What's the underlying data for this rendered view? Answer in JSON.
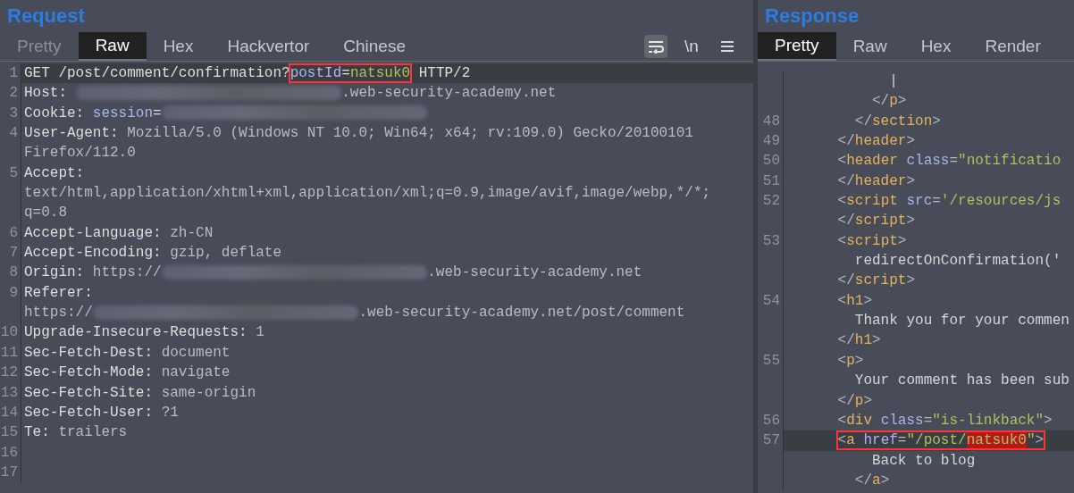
{
  "request": {
    "title": "Request",
    "tabs": [
      {
        "label": "Pretty",
        "selected": false,
        "disabled": true
      },
      {
        "label": "Raw",
        "selected": true,
        "disabled": false
      },
      {
        "label": "Hex",
        "selected": false,
        "disabled": false
      },
      {
        "label": "Hackvertor",
        "selected": false,
        "disabled": false
      },
      {
        "label": "Chinese",
        "selected": false,
        "disabled": false
      }
    ],
    "toolbar": [
      {
        "kind": "wrap",
        "selected": true
      },
      {
        "kind": "newline",
        "label": "\\n",
        "selected": false
      },
      {
        "kind": "menu",
        "selected": false
      }
    ],
    "lines": [
      {
        "number": "1",
        "current": true,
        "segments": [
          {
            "kind": "plain",
            "text": "GET /post/comment/confirmation?"
          },
          {
            "kind": "outlined",
            "segments": [
              {
                "kind": "param",
                "text": "postId"
              },
              {
                "kind": "plain",
                "text": "="
              },
              {
                "kind": "string",
                "text": "natsuk0"
              }
            ]
          },
          {
            "kind": "plain",
            "text": " HTTP/2"
          }
        ]
      },
      {
        "number": "2",
        "current": false,
        "segments": [
          {
            "kind": "name",
            "text": "Host: "
          },
          {
            "kind": "blur"
          },
          {
            "kind": "value",
            "text": ".web-security-academy.net"
          }
        ]
      },
      {
        "number": "3",
        "current": false,
        "segments": [
          {
            "kind": "name",
            "text": "Cookie: "
          },
          {
            "kind": "param",
            "text": "session"
          },
          {
            "kind": "plain",
            "text": "="
          },
          {
            "kind": "blur"
          }
        ]
      },
      {
        "number": "4",
        "current": false,
        "segments": [
          {
            "kind": "name",
            "text": "User-Agent: "
          },
          {
            "kind": "value",
            "text": "Mozilla/5.0 (Windows NT 10.0; Win64; x64; rv:109.0) Gecko/20100101"
          }
        ]
      },
      {
        "current": false,
        "segments": [
          {
            "kind": "value",
            "text": "Firefox/112.0"
          }
        ]
      },
      {
        "number": "5",
        "current": false,
        "segments": [
          {
            "kind": "name",
            "text": "Accept:"
          }
        ]
      },
      {
        "current": false,
        "segments": [
          {
            "kind": "value",
            "text": "text/html,application/xhtml+xml,application/xml;q=0.9,image/avif,image/webp,*/*;"
          }
        ]
      },
      {
        "current": false,
        "segments": [
          {
            "kind": "value",
            "text": "q=0.8"
          }
        ]
      },
      {
        "number": "6",
        "current": false,
        "segments": [
          {
            "kind": "name",
            "text": "Accept-Language: "
          },
          {
            "kind": "value",
            "text": "zh-CN"
          }
        ]
      },
      {
        "number": "7",
        "current": false,
        "segments": [
          {
            "kind": "name",
            "text": "Accept-Encoding: "
          },
          {
            "kind": "value",
            "text": "gzip, deflate"
          }
        ]
      },
      {
        "number": "8",
        "current": false,
        "segments": [
          {
            "kind": "name",
            "text": "Origin: "
          },
          {
            "kind": "value",
            "text": "https://"
          },
          {
            "kind": "blur"
          },
          {
            "kind": "value",
            "text": ".web-security-academy.net"
          }
        ]
      },
      {
        "number": "9",
        "current": false,
        "segments": [
          {
            "kind": "name",
            "text": "Referer:"
          }
        ]
      },
      {
        "current": false,
        "segments": [
          {
            "kind": "value",
            "text": "https://"
          },
          {
            "kind": "blur"
          },
          {
            "kind": "value",
            "text": ".web-security-academy.net/post/comment"
          }
        ]
      },
      {
        "number": "10",
        "current": false,
        "segments": [
          {
            "kind": "name",
            "text": "Upgrade-Insecure-Requests: "
          },
          {
            "kind": "value",
            "text": "1"
          }
        ]
      },
      {
        "number": "11",
        "current": false,
        "segments": [
          {
            "kind": "name",
            "text": "Sec-Fetch-Dest: "
          },
          {
            "kind": "value",
            "text": "document"
          }
        ]
      },
      {
        "number": "12",
        "current": false,
        "segments": [
          {
            "kind": "name",
            "text": "Sec-Fetch-Mode: "
          },
          {
            "kind": "value",
            "text": "navigate"
          }
        ]
      },
      {
        "number": "13",
        "current": false,
        "segments": [
          {
            "kind": "name",
            "text": "Sec-Fetch-Site: "
          },
          {
            "kind": "value",
            "text": "same-origin"
          }
        ]
      },
      {
        "number": "14",
        "current": false,
        "segments": [
          {
            "kind": "name",
            "text": "Sec-Fetch-User: "
          },
          {
            "kind": "value",
            "text": "?1"
          }
        ]
      },
      {
        "number": "15",
        "current": false,
        "segments": [
          {
            "kind": "name",
            "text": "Te: "
          },
          {
            "kind": "value",
            "text": "trailers"
          }
        ]
      },
      {
        "number": "16",
        "current": false
      },
      {
        "number": "17",
        "current": false
      }
    ]
  },
  "response": {
    "title": "Response",
    "tabs": [
      {
        "label": "Pretty",
        "selected": true,
        "disabled": false
      },
      {
        "label": "Raw",
        "selected": false,
        "disabled": false
      },
      {
        "label": "Hex",
        "selected": false,
        "disabled": false
      },
      {
        "label": "Render",
        "selected": false,
        "disabled": false
      }
    ],
    "lines": [
      {
        "current": false,
        "segments": [
          {
            "kind": "text",
            "text": "            |"
          }
        ]
      },
      {
        "current": false,
        "segments": [
          {
            "kind": "punct",
            "text": "          </"
          },
          {
            "kind": "tag",
            "text": "p"
          },
          {
            "kind": "punct",
            "text": ">"
          }
        ]
      },
      {
        "number": "48",
        "current": false,
        "segments": [
          {
            "kind": "punct",
            "text": "        </"
          },
          {
            "kind": "tag",
            "text": "section"
          },
          {
            "kind": "punct",
            "text": ">"
          }
        ]
      },
      {
        "number": "49",
        "current": false,
        "segments": [
          {
            "kind": "punct",
            "text": "      </"
          },
          {
            "kind": "tag",
            "text": "header"
          },
          {
            "kind": "punct",
            "text": ">"
          }
        ]
      },
      {
        "number": "50",
        "current": false,
        "segments": [
          {
            "kind": "punct",
            "text": "      <"
          },
          {
            "kind": "tag",
            "text": "header"
          },
          {
            "kind": "attr",
            "text": " class"
          },
          {
            "kind": "punct",
            "text": "="
          },
          {
            "kind": "string",
            "text": "\"notificatio"
          }
        ]
      },
      {
        "number": "51",
        "current": false,
        "segments": [
          {
            "kind": "punct",
            "text": "      </"
          },
          {
            "kind": "tag",
            "text": "header"
          },
          {
            "kind": "punct",
            "text": ">"
          }
        ]
      },
      {
        "number": "52",
        "current": false,
        "segments": [
          {
            "kind": "punct",
            "text": "      <"
          },
          {
            "kind": "tag",
            "text": "script"
          },
          {
            "kind": "attr",
            "text": " src"
          },
          {
            "kind": "punct",
            "text": "="
          },
          {
            "kind": "string",
            "text": "'/resources/js"
          }
        ]
      },
      {
        "current": false,
        "segments": [
          {
            "kind": "punct",
            "text": "      </"
          },
          {
            "kind": "tag",
            "text": "script"
          },
          {
            "kind": "punct",
            "text": ">"
          }
        ]
      },
      {
        "number": "53",
        "current": false,
        "segments": [
          {
            "kind": "punct",
            "text": "      <"
          },
          {
            "kind": "tag",
            "text": "script"
          },
          {
            "kind": "punct",
            "text": ">"
          }
        ]
      },
      {
        "current": false,
        "segments": [
          {
            "kind": "text",
            "text": "        redirectOnConfirmation('"
          }
        ]
      },
      {
        "current": false,
        "segments": [
          {
            "kind": "punct",
            "text": "      </"
          },
          {
            "kind": "tag",
            "text": "script"
          },
          {
            "kind": "punct",
            "text": ">"
          }
        ]
      },
      {
        "number": "54",
        "current": false,
        "segments": [
          {
            "kind": "punct",
            "text": "      <"
          },
          {
            "kind": "tag",
            "text": "h1"
          },
          {
            "kind": "punct",
            "text": ">"
          }
        ]
      },
      {
        "current": false,
        "segments": [
          {
            "kind": "text",
            "text": "        Thank you for your commen"
          }
        ]
      },
      {
        "current": false,
        "segments": [
          {
            "kind": "punct",
            "text": "      </"
          },
          {
            "kind": "tag",
            "text": "h1"
          },
          {
            "kind": "punct",
            "text": ">"
          }
        ]
      },
      {
        "number": "55",
        "current": false,
        "segments": [
          {
            "kind": "punct",
            "text": "      <"
          },
          {
            "kind": "tag",
            "text": "p"
          },
          {
            "kind": "punct",
            "text": ">"
          }
        ]
      },
      {
        "current": false,
        "segments": [
          {
            "kind": "text",
            "text": "        Your comment has been sub"
          }
        ]
      },
      {
        "current": false,
        "segments": [
          {
            "kind": "punct",
            "text": "      </"
          },
          {
            "kind": "tag",
            "text": "p"
          },
          {
            "kind": "punct",
            "text": ">"
          }
        ]
      },
      {
        "number": "56",
        "current": false,
        "segments": [
          {
            "kind": "punct",
            "text": "      <"
          },
          {
            "kind": "tag",
            "text": "div"
          },
          {
            "kind": "attr",
            "text": " class"
          },
          {
            "kind": "punct",
            "text": "="
          },
          {
            "kind": "string",
            "text": "\"is-linkback\""
          },
          {
            "kind": "punct",
            "text": ">"
          }
        ]
      },
      {
        "number": "57",
        "current": true,
        "segments": [
          {
            "kind": "outlined",
            "segments": [
              {
                "kind": "punct",
                "text": "<"
              },
              {
                "kind": "tag",
                "text": "a"
              },
              {
                "kind": "attr",
                "text": " href"
              },
              {
                "kind": "punct",
                "text": "="
              },
              {
                "kind": "string",
                "text": "\"/post/"
              },
              {
                "kind": "match",
                "text": "natsuk0"
              },
              {
                "kind": "string",
                "text": "\""
              },
              {
                "kind": "punct",
                "text": ">"
              }
            ]
          }
        ]
      },
      {
        "current": false,
        "segments": [
          {
            "kind": "text",
            "text": "          Back to blog"
          }
        ]
      },
      {
        "current": false,
        "segments": [
          {
            "kind": "punct",
            "text": "        </"
          },
          {
            "kind": "tag",
            "text": "a"
          },
          {
            "kind": "punct",
            "text": ">"
          }
        ]
      }
    ]
  }
}
